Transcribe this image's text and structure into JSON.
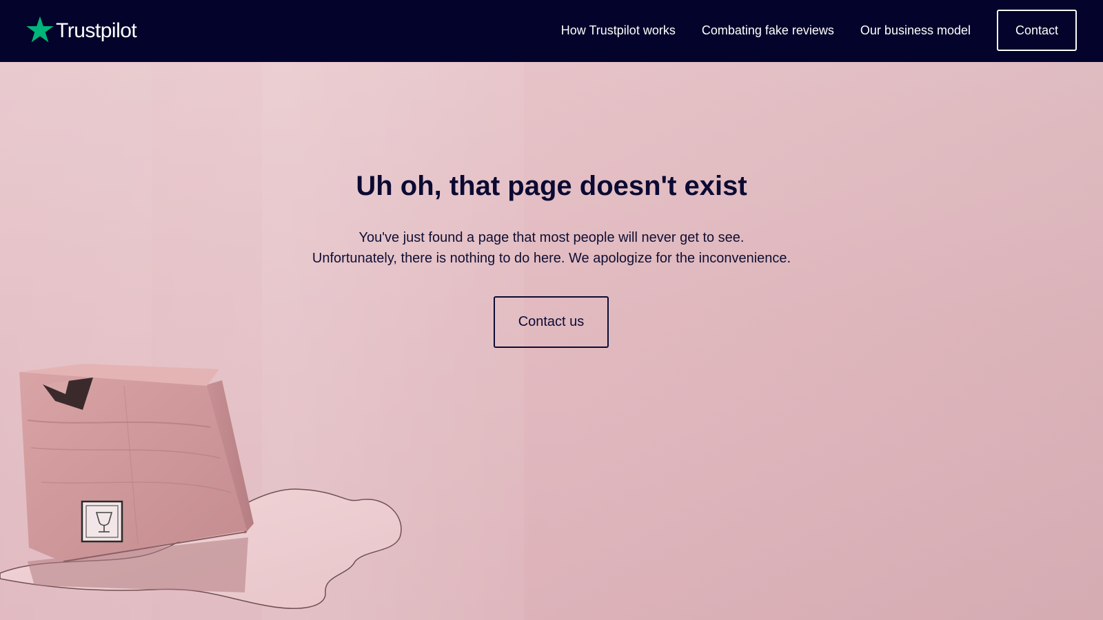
{
  "header": {
    "logo_text": "Trustpilot",
    "logo_icon": "star-icon",
    "nav": [
      {
        "label": "How Trustpilot works"
      },
      {
        "label": "Combating fake reviews"
      },
      {
        "label": "Our business model"
      }
    ],
    "contact_label": "Contact"
  },
  "main": {
    "headline": "Uh oh, that page doesn't exist",
    "message_line1": "You've just found a page that most people will never get to see.",
    "message_line2": "Unfortunately, there is nothing to do here. We apologize for the inconvenience.",
    "cta_label": "Contact us",
    "illustration_icon": "wine-glass-icon"
  },
  "colors": {
    "header_bg": "#04032b",
    "brand_green": "#00b67a",
    "hero_bg": "#e2bec3",
    "text_dark": "#0b0a33"
  }
}
